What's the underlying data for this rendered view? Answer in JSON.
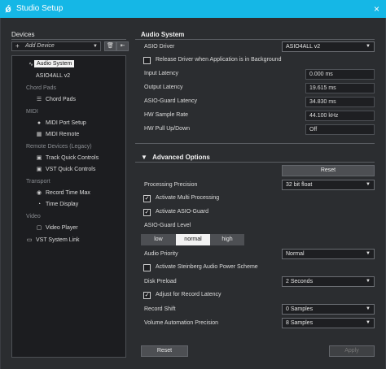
{
  "window": {
    "title": "Studio Setup",
    "logo": "cubase-logo-icon",
    "close": "×"
  },
  "devices": {
    "label": "Devices",
    "add_device": "Add Device",
    "tree": [
      {
        "type": "item",
        "label": "Audio System",
        "icon": "waveform-icon"
      },
      {
        "type": "item",
        "label": "ASIO4ALL v2"
      },
      {
        "type": "category",
        "label": "Chord Pads"
      },
      {
        "type": "item",
        "label": "Chord Pads",
        "icon": "chord-pads-icon"
      },
      {
        "type": "category",
        "label": "MIDI"
      },
      {
        "type": "item",
        "label": "MIDI Port Setup",
        "icon": "midi-port-icon"
      },
      {
        "type": "item",
        "label": "MIDI Remote",
        "icon": "midi-remote-icon"
      },
      {
        "type": "category",
        "label": "Remote Devices (Legacy)"
      },
      {
        "type": "item",
        "label": "Track Quick Controls",
        "icon": "grid-icon"
      },
      {
        "type": "item",
        "label": "VST Quick Controls",
        "icon": "grid-icon"
      },
      {
        "type": "category",
        "label": "Transport"
      },
      {
        "type": "item",
        "label": "Record Time Max",
        "icon": "record-icon"
      },
      {
        "type": "item",
        "label": "Time Display",
        "icon": "clock-icon"
      },
      {
        "type": "category",
        "label": "Video"
      },
      {
        "type": "item",
        "label": "Video Player",
        "icon": "video-icon"
      },
      {
        "type": "item",
        "label": "VST System Link",
        "icon": "monitor-icon"
      }
    ]
  },
  "audio_system": {
    "title": "Audio System",
    "asio_driver_label": "ASIO Driver",
    "asio_driver_value": "ASIO4ALL v2",
    "release_driver_label": "Release Driver when Application is in Background",
    "input_latency_label": "Input Latency",
    "input_latency": "0.000 ms",
    "output_latency_label": "Output Latency",
    "output_latency": "19.615 ms",
    "asio_guard_latency_label": "ASIO-Guard Latency",
    "asio_guard_latency": "34.830 ms",
    "hw_sample_rate_label": "HW Sample Rate",
    "hw_sample_rate": "44.100 kHz",
    "hw_pullupdown_label": "HW Pull Up/Down",
    "hw_pullupdown": "Off"
  },
  "advanced": {
    "title": "Advanced Options",
    "reset": "Reset",
    "processing_precision_label": "Processing Precision",
    "processing_precision": "32 bit float",
    "multi_processing_label": "Activate Multi Processing",
    "asio_guard_label": "Activate ASIO-Guard",
    "asio_guard_level_label": "ASIO-Guard Level",
    "levels": [
      "low",
      "normal",
      "high"
    ],
    "selected_level": "normal",
    "audio_priority_label": "Audio Priority",
    "audio_priority": "Normal",
    "power_scheme_label": "Activate Steinberg Audio Power Scheme",
    "disk_preload_label": "Disk Preload",
    "disk_preload": "2 Seconds",
    "adjust_record_latency_label": "Adjust for Record Latency",
    "record_shift_label": "Record Shift",
    "record_shift": "0 Samples",
    "volume_automation_label": "Volume Automation Precision",
    "volume_automation": "8 Samples"
  },
  "footer": {
    "reset": "Reset",
    "apply": "Apply"
  }
}
